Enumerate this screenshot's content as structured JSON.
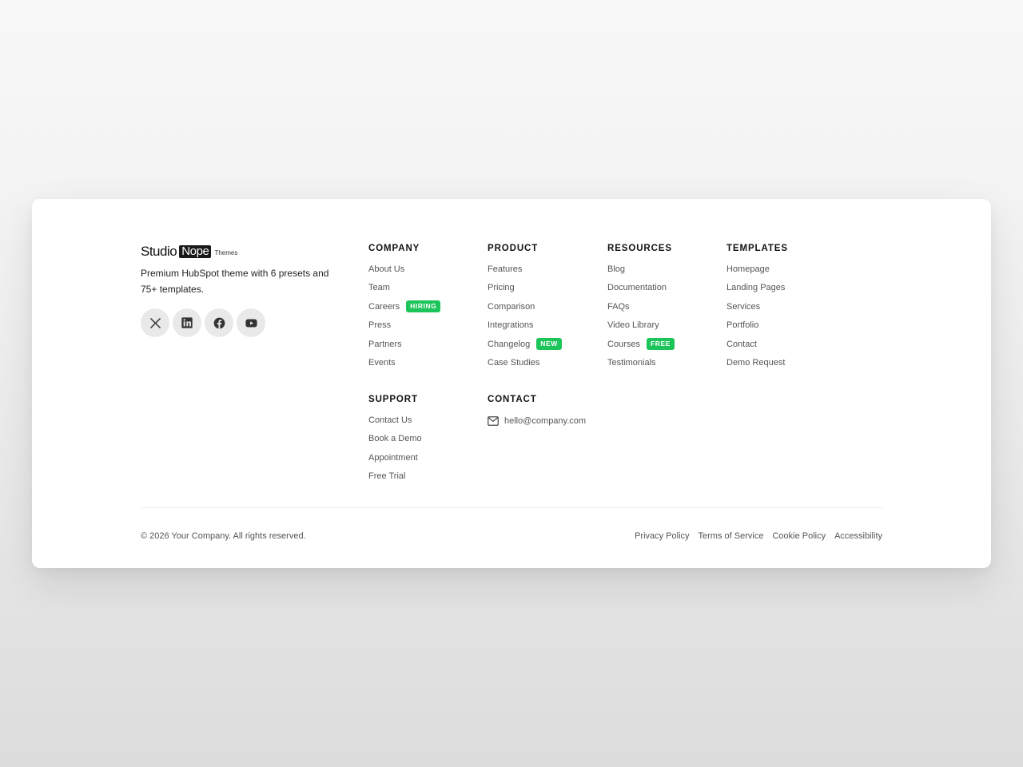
{
  "brand": {
    "logo_primary": "Studio",
    "logo_highlight": "Nope",
    "logo_suffix": "Themes",
    "tagline": "Premium HubSpot theme with 6 presets and 75+ templates."
  },
  "socials": [
    {
      "name": "x-icon",
      "label": "X"
    },
    {
      "name": "linkedin-icon",
      "label": "LinkedIn"
    },
    {
      "name": "facebook-icon",
      "label": "Facebook"
    },
    {
      "name": "youtube-icon",
      "label": "YouTube"
    }
  ],
  "columns": {
    "company": {
      "title": "COMPANY",
      "links": [
        "About Us",
        "Team",
        "Careers",
        "Press",
        "Partners",
        "Events"
      ],
      "badge_careers": "HIRING"
    },
    "product": {
      "title": "PRODUCT",
      "links": [
        "Features",
        "Pricing",
        "Comparison",
        "Integrations",
        "Changelog",
        "Case Studies"
      ],
      "badge_changelog": "NEW"
    },
    "resources": {
      "title": "RESOURCES",
      "links": [
        "Blog",
        "Documentation",
        "FAQs",
        "Video Library",
        "Courses",
        "Testimonials"
      ],
      "badge_courses": "FREE"
    },
    "templates": {
      "title": "TEMPLATES",
      "links": [
        "Homepage",
        "Landing Pages",
        "Services",
        "Portfolio",
        "Contact",
        "Demo Request"
      ]
    },
    "support": {
      "title": "SUPPORT",
      "links": [
        "Contact Us",
        "Book a Demo",
        "Appointment",
        "Free Trial"
      ]
    },
    "contact": {
      "title": "CONTACT",
      "email": "hello@company.com"
    }
  },
  "bottom": {
    "copyright": "© 2026 Your Company. All rights reserved.",
    "legal": [
      "Privacy Policy",
      "Terms of Service",
      "Cookie Policy",
      "Accessibility"
    ]
  },
  "colors": {
    "badge": "#1cc45a",
    "text_muted": "#555555",
    "heading": "#111111"
  }
}
